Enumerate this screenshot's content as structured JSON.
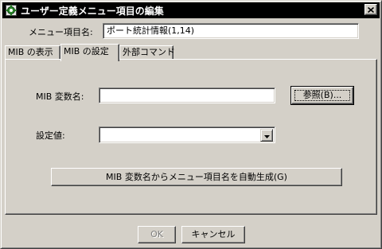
{
  "window": {
    "title": "ユーザー定義メニュー項目の編集",
    "title_bar_color": "#000000"
  },
  "item_name": {
    "label": "メニュー項目名:",
    "value": "ポート統計情報(1,14)"
  },
  "tabs": [
    {
      "label": "MIB の表示",
      "active": false
    },
    {
      "label": "MIB の設定",
      "active": true
    },
    {
      "label": "外部コマンド",
      "active": false
    }
  ],
  "mib_settings": {
    "variable_label": "MIB 変数名:",
    "variable_value": "",
    "browse_button": "参照(B)...",
    "setting_label": "設定値:",
    "setting_value": "",
    "auto_generate_button": "MIB 変数名からメニュー項目名を自動生成(G)"
  },
  "footer": {
    "ok_label": "OK",
    "cancel_label": "キャンセル"
  },
  "icons": {
    "app": "app-settings-icon",
    "close": "close-icon",
    "dropdown": "chevron-down-icon"
  }
}
